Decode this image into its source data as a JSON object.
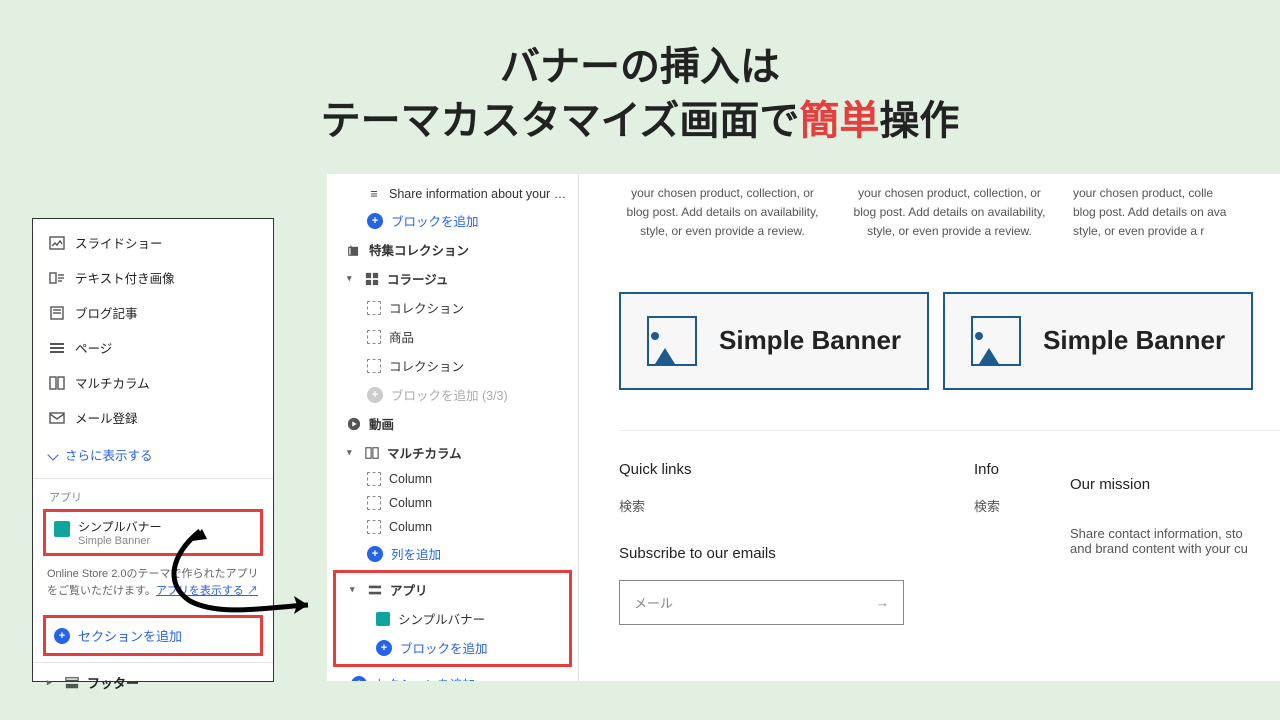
{
  "headline": {
    "line1": "バナーの挿入は",
    "line2a": "テーマカスタマイズ画面で",
    "accent": "簡単",
    "line2b": "操作"
  },
  "panel_left": {
    "items": [
      {
        "icon": "image",
        "label": "スライドショー"
      },
      {
        "icon": "image-text",
        "label": "テキスト付き画像"
      },
      {
        "icon": "blog",
        "label": "ブログ記事"
      },
      {
        "icon": "page",
        "label": "ページ"
      },
      {
        "icon": "columns",
        "label": "マルチカラム"
      },
      {
        "icon": "mail",
        "label": "メール登録"
      }
    ],
    "show_more": "さらに表示する",
    "apps_header": "アプリ",
    "app_card": {
      "name": "シンプルバナー",
      "sub": "Simple Banner"
    },
    "help_text_a": "Online Store 2.0のテーマで作られたアプリをご覧いただけます。",
    "help_link": "アプリを表示する",
    "add_section": "セクションを追加",
    "footer": "フッター"
  },
  "tree": {
    "share_info": "Share information about your b…",
    "add_block": "ブロックを追加",
    "featured": "特集コレクション",
    "collage": "コラージュ",
    "collage_items": [
      "コレクション",
      "商品",
      "コレクション"
    ],
    "add_block_limit": "ブロックを追加 (3/3)",
    "video": "動画",
    "multicolumn": "マルチカラム",
    "columns": [
      "Column",
      "Column",
      "Column"
    ],
    "add_col": "列を追加",
    "app_section": "アプリ",
    "app_item": "シンプルバナー",
    "app_add_block": "ブロックを追加",
    "add_section": "セクションを追加"
  },
  "preview": {
    "card_text": "your chosen product, collection, or blog post. Add details on availability, style, or even provide a review.",
    "card_text_cut": "your chosen product, colle\nblog post. Add details on ava\nstyle, or even provide a r",
    "banner_label": "Simple Banner",
    "footer": {
      "quick": {
        "h": "Quick links",
        "link": "検索"
      },
      "info": {
        "h": "Info",
        "link": "検索"
      },
      "mission": {
        "h": "Our mission",
        "text": "Share contact information, sto\nand brand content with your cu"
      }
    },
    "subscribe": {
      "h": "Subscribe to our emails",
      "placeholder": "メール"
    }
  }
}
